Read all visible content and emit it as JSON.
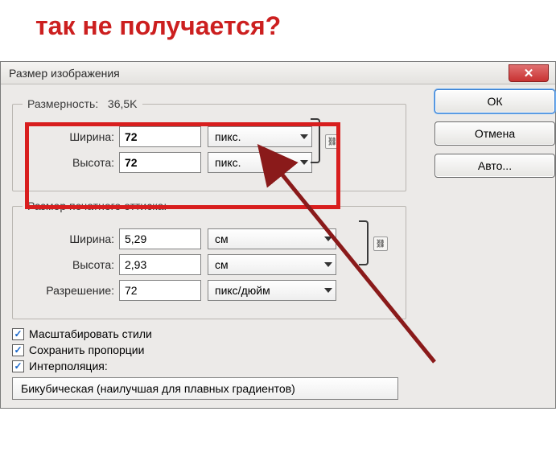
{
  "overlay": {
    "text": "так не получается?"
  },
  "dialog": {
    "title": "Размер изображения",
    "close_glyph": "✕"
  },
  "dimensions": {
    "legend_prefix": "Размерность:",
    "size": "36,5K",
    "width_label": "Ширина:",
    "width_value": "72",
    "width_unit": "пикс.",
    "height_label": "Высота:",
    "height_value": "72",
    "height_unit": "пикс."
  },
  "print": {
    "legend": "Размер печатного оттиска:",
    "width_label": "Ширина:",
    "width_value": "5,29",
    "width_unit": "см",
    "height_label": "Высота:",
    "height_value": "2,93",
    "height_unit": "см",
    "res_label": "Разрешение:",
    "res_value": "72",
    "res_unit": "пикс/дюйм"
  },
  "buttons": {
    "ok": "ОК",
    "cancel": "Отмена",
    "auto": "Авто..."
  },
  "checks": {
    "scale_styles": "Масштабировать стили",
    "constrain": "Сохранить пропорции",
    "interp": "Интерполяция:"
  },
  "interp_combo": "Бикубическая (наилучшая для плавных градиентов)",
  "icons": {
    "link": "⛓"
  },
  "annotation": {
    "color": "#8a1a1a"
  }
}
